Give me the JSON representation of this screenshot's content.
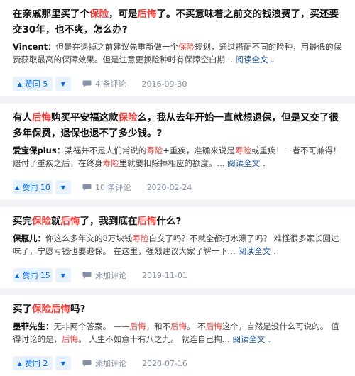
{
  "labels": {
    "upvote_prefix": "赞同",
    "read_more": "阅读全文",
    "chevron": "⌄",
    "down_arrow": "▼",
    "up_arrow": "▲"
  },
  "cards": [
    {
      "title": [
        "在亲戚那里买了个",
        {
          "hl": "保险"
        },
        "，可是",
        {
          "hl": "后悔"
        },
        "了。不买意味着之前交的钱浪费了，买还要交30年，也不爽，怎么办?"
      ],
      "author": "Vincent：",
      "excerpt": [
        "但是在退掉之前建议先重新做一个",
        {
          "hl": "保险"
        },
        "规划，通过搭配不同的险种，用最低的保费获取最高的保障效果。但是注意更换险种时有保障空白期..."
      ],
      "upvotes": "5",
      "comments": "4 条评论",
      "date": "2016-09-30"
    },
    {
      "title": [
        "有人",
        {
          "hl": "后悔"
        },
        "购买平安福这款",
        {
          "hl": "保险"
        },
        "么，我从去年开始一直就想退保，但是又交了很多年保费，退保也退不了多少钱。?"
      ],
      "author": "爱宝保plus：",
      "excerpt": [
        "某福并不是人们常说的",
        {
          "hl": "寿险"
        },
        "+重疾，准确来说是",
        {
          "hl": "寿险"
        },
        "或重疾！二者不可兼得！ 赔付了重疾之后，在终身",
        {
          "hl": "寿险"
        },
        "里就要扣除掉相应的额度。..."
      ],
      "upvotes": "10",
      "comments": "10 条评论",
      "date": "2020-02-24"
    },
    {
      "title": [
        "买完",
        {
          "hl": "保险"
        },
        "就",
        {
          "hl": "后悔"
        },
        "了，我到底在",
        {
          "hl": "后悔"
        },
        "什么?"
      ],
      "author": "保瓶儿：",
      "excerpt": [
        "你这么多年交的8万块钱",
        {
          "hl": "寿险"
        },
        "白交了吗？不就全都打水漂了吗？ 难怪很多家长回过味了，宁愿亏钱也要退保。 在这里，强烈建议大家了解一下..."
      ],
      "upvotes": "15",
      "comments": "添加评论",
      "date": "2019-11-01"
    },
    {
      "title": [
        "买了",
        {
          "hl": "保险"
        },
        {
          "hl": "后悔"
        },
        "吗?"
      ],
      "author": "墨菲先生：",
      "excerpt": [
        "无非两个答案。 ——",
        {
          "hl": "后悔"
        },
        "，和不",
        {
          "hl": "后悔"
        },
        "。 不",
        {
          "hl": "后悔"
        },
        "这个，自然是没什么可说的。 值得讨论的是，",
        {
          "hl": "后悔"
        },
        "。 人生不如意十有八之九。 就连自己掏..."
      ],
      "upvotes": "2",
      "comments": "添加评论",
      "date": "2020-07-16"
    }
  ],
  "colors": {
    "accent": "#056de8",
    "highlight": "#f1403c",
    "link": "#175199",
    "meta": "#8590a6",
    "background": "#f0f2f5"
  }
}
